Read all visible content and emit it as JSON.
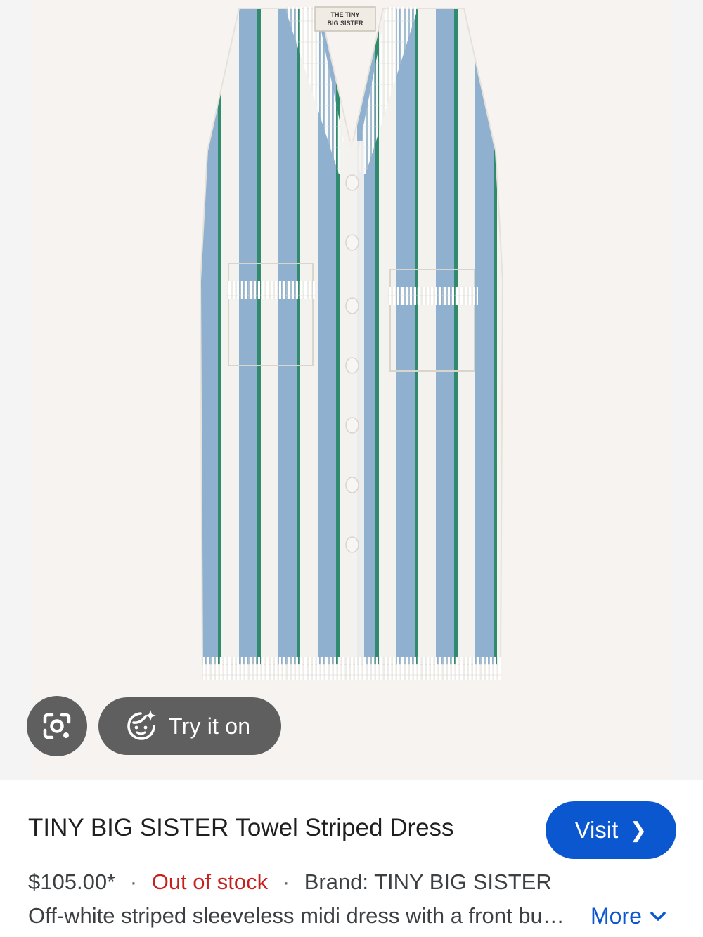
{
  "product_image": {
    "tag_text_line1": "THE TINY",
    "tag_text_line2": "BIG SISTER",
    "colors": {
      "background": "#f6f3f1",
      "fabric_white": "#f3f2ee",
      "stripe_blue": "#8fb1cf",
      "stripe_green": "#2f8a6e"
    }
  },
  "overlay_buttons": {
    "lens_icon": "google-lens-icon",
    "try_on_icon": "try-on-face-sparkle-icon",
    "try_on_label": "Try it on"
  },
  "listing": {
    "title": "TINY BIG SISTER Towel Striped Dress",
    "visit_label": "Visit",
    "price": "$105.00*",
    "stock_status": "Out of stock",
    "brand": "Brand: TINY BIG SISTER",
    "description": "Off-white striped sleeveless midi dress with a front button closure, fringe-trimmed V-neck and patch pockets.",
    "more_label": "More",
    "colors": {
      "accent": "#0b57d0",
      "out_of_stock": "#c5221f"
    }
  }
}
